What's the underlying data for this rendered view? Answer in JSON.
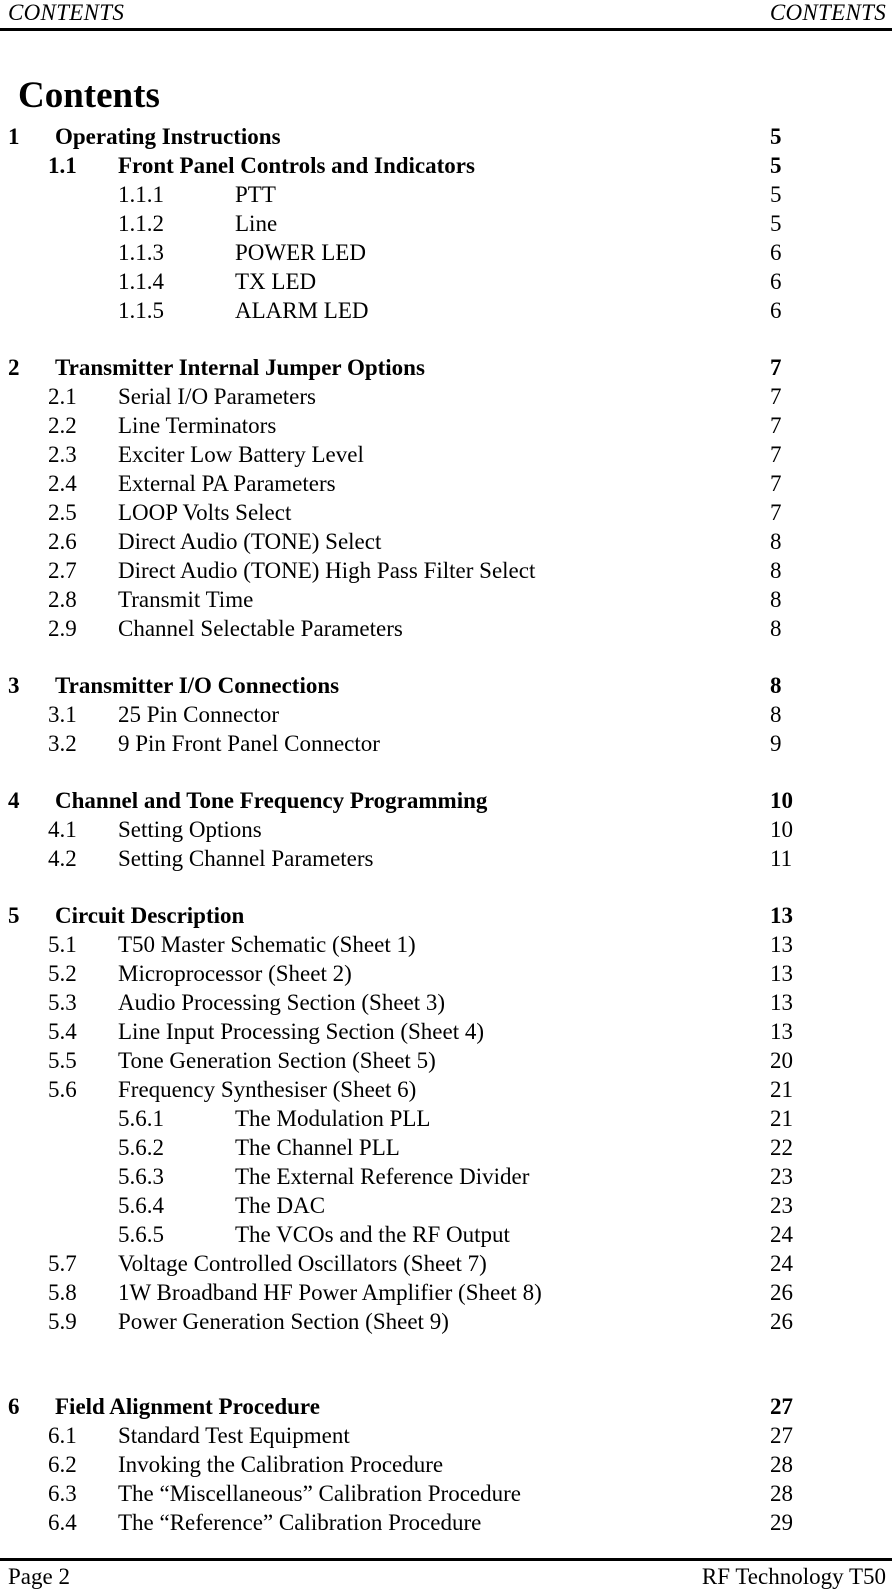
{
  "header": {
    "left": "CONTENTS",
    "right": "CONTENTS"
  },
  "title": "Contents",
  "toc": {
    "groups": [
      {
        "entries": [
          {
            "level": 1,
            "num": "1",
            "title": "Operating Instructions",
            "page": "5"
          },
          {
            "level": 2,
            "num": "1.1",
            "title": "Front Panel Controls and Indicators",
            "page": "5",
            "bold": true
          },
          {
            "level": 3,
            "num": "1.1.1",
            "title": "PTT",
            "page": "5"
          },
          {
            "level": 3,
            "num": "1.1.2",
            "title": "Line",
            "page": "5"
          },
          {
            "level": 3,
            "num": "1.1.3",
            "title": "POWER LED",
            "page": "6"
          },
          {
            "level": 3,
            "num": "1.1.4",
            "title": "TX LED",
            "page": "6"
          },
          {
            "level": 3,
            "num": "1.1.5",
            "title": "ALARM LED",
            "page": "6"
          }
        ]
      },
      {
        "entries": [
          {
            "level": 1,
            "num": "2",
            "title": "Transmitter Internal Jumper Options",
            "page": "7"
          },
          {
            "level": 2,
            "num": "2.1",
            "title": "Serial I/O Parameters",
            "page": "7"
          },
          {
            "level": 2,
            "num": "2.2",
            "title": "Line Terminators",
            "page": "7"
          },
          {
            "level": 2,
            "num": "2.3",
            "title": "Exciter Low Battery Level",
            "page": "7"
          },
          {
            "level": 2,
            "num": "2.4",
            "title": "External PA Parameters",
            "page": "7"
          },
          {
            "level": 2,
            "num": "2.5",
            "title": "LOOP Volts Select",
            "page": "7"
          },
          {
            "level": 2,
            "num": "2.6",
            "title": "Direct Audio (TONE) Select",
            "page": "8"
          },
          {
            "level": 2,
            "num": "2.7",
            "title": "Direct Audio (TONE) High Pass Filter Select",
            "page": "8"
          },
          {
            "level": 2,
            "num": "2.8",
            "title": "Transmit Time",
            "page": "8"
          },
          {
            "level": 2,
            "num": "2.9",
            "title": "Channel Selectable Parameters",
            "page": "8"
          }
        ]
      },
      {
        "entries": [
          {
            "level": 1,
            "num": "3",
            "title": "Transmitter I/O Connections",
            "page": "8"
          },
          {
            "level": 2,
            "num": "3.1",
            "title": "25 Pin Connector",
            "page": "8"
          },
          {
            "level": 2,
            "num": "3.2",
            "title": "9 Pin Front Panel Connector",
            "page": "9"
          }
        ]
      },
      {
        "entries": [
          {
            "level": 1,
            "num": "4",
            "title": "Channel and Tone Frequency Programming",
            "page": "10"
          },
          {
            "level": 2,
            "num": "4.1",
            "title": "Setting Options",
            "page": "10"
          },
          {
            "level": 2,
            "num": "4.2",
            "title": "Setting Channel Parameters",
            "page": "11"
          }
        ]
      },
      {
        "entries": [
          {
            "level": 1,
            "num": "5",
            "title": "Circuit Description",
            "page": "13"
          },
          {
            "level": 2,
            "num": "5.1",
            "title": "T50 Master Schematic (Sheet 1)",
            "page": "13"
          },
          {
            "level": 2,
            "num": "5.2",
            "title": "Microprocessor (Sheet 2)",
            "page": "13"
          },
          {
            "level": 2,
            "num": "5.3",
            "title": "Audio Processing Section (Sheet 3)",
            "page": "13"
          },
          {
            "level": 2,
            "num": "5.4",
            "title": "Line Input Processing Section (Sheet 4)",
            "page": "13"
          },
          {
            "level": 2,
            "num": "5.5",
            "title": "Tone Generation Section (Sheet 5)",
            "page": "20"
          },
          {
            "level": 2,
            "num": "5.6",
            "title": "Frequency Synthesiser (Sheet 6)",
            "page": "21"
          },
          {
            "level": 3,
            "num": "5.6.1",
            "title": "The Modulation PLL",
            "page": "21"
          },
          {
            "level": 3,
            "num": "5.6.2",
            "title": "The Channel PLL",
            "page": "22"
          },
          {
            "level": 3,
            "num": "5.6.3",
            "title": "The External Reference Divider",
            "page": "23"
          },
          {
            "level": 3,
            "num": "5.6.4",
            "title": "The DAC",
            "page": "23"
          },
          {
            "level": 3,
            "num": "5.6.5",
            "title": "The VCOs and the RF Output",
            "page": "24"
          },
          {
            "level": 2,
            "num": "5.7",
            "title": "Voltage Controlled Oscillators (Sheet 7)",
            "page": "24"
          },
          {
            "level": 2,
            "num": "5.8",
            "title": "1W Broadband HF Power Amplifier (Sheet 8)",
            "page": "26"
          },
          {
            "level": 2,
            "num": "5.9",
            "title": "Power Generation Section (Sheet 9)",
            "page": "26"
          }
        ]
      },
      {
        "big_gap_before": true,
        "entries": [
          {
            "level": 1,
            "num": "6",
            "title": "Field Alignment Procedure",
            "page": "27"
          },
          {
            "level": 2,
            "num": "6.1",
            "title": "Standard Test Equipment",
            "page": "27"
          },
          {
            "level": 2,
            "num": "6.2",
            "title": "Invoking the Calibration Procedure",
            "page": "28"
          },
          {
            "level": 2,
            "num": "6.3",
            "title": "The “Miscellaneous” Calibration Procedure",
            "page": "28"
          },
          {
            "level": 2,
            "num": "6.4",
            "title": "The “Reference” Calibration Procedure",
            "page": "29"
          }
        ]
      }
    ]
  },
  "footer": {
    "left": "Page 2",
    "right": "RF Technology T50"
  }
}
